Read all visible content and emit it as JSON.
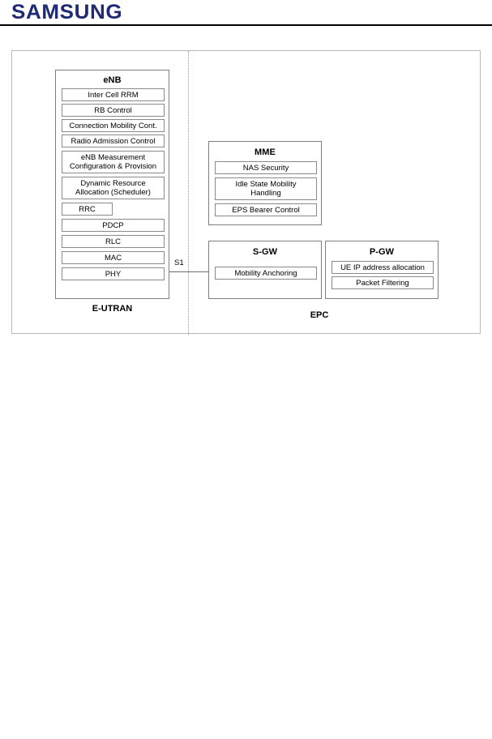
{
  "header": {
    "brand": "SAMSUNG",
    "brand_color": "#1f2a72"
  },
  "figure": {
    "divider_style": "dotted",
    "regions": [
      {
        "id": "e-utran",
        "label": "E-UTRAN"
      },
      {
        "id": "epc",
        "label": "EPC"
      }
    ],
    "interface": {
      "label": "S1"
    },
    "nodes": [
      {
        "id": "enb",
        "title": "eNB",
        "region": "e-utran",
        "functions": [
          "Inter Cell RRM",
          "RB Control",
          "Connection Mobility Cont.",
          "Radio Admission Control",
          "eNB Measurement\nConfiguration & Provision",
          "Dynamic Resource\nAllocation (Scheduler)",
          "RRC",
          "PDCP",
          "RLC",
          "MAC",
          "PHY"
        ]
      },
      {
        "id": "mme",
        "title": "MME",
        "region": "epc",
        "functions": [
          "NAS Security",
          "Idle State Mobility\nHandling",
          "EPS Bearer Control"
        ]
      },
      {
        "id": "sgw",
        "title": "S-GW",
        "region": "epc",
        "functions": [
          "Mobility Anchoring"
        ]
      },
      {
        "id": "pgw",
        "title": "P-GW",
        "region": "epc",
        "functions": [
          "UE IP address allocation",
          "Packet Filtering"
        ]
      }
    ]
  }
}
